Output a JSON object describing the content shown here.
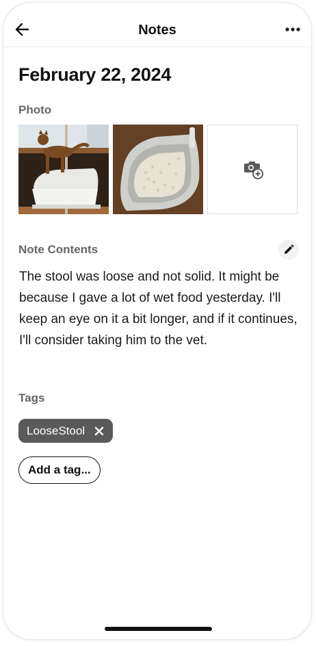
{
  "header": {
    "title": "Notes",
    "back_icon": "arrow-left-icon",
    "more_icon": "more-horizontal-icon"
  },
  "date": "February 22, 2024",
  "photo_section": {
    "label": "Photo",
    "photos": [
      {
        "description_icon": "photo-cat-litter-box"
      },
      {
        "description_icon": "photo-litter-tray"
      }
    ],
    "add_icon": "camera-plus-icon"
  },
  "note": {
    "label": "Note Contents",
    "edit_icon": "pencil-icon",
    "text": "The stool was loose and not solid. It might be because I gave a lot of wet food yesterday. I'll keep an eye on it a bit longer, and if it continues, I'll consider taking him to the vet."
  },
  "tags": {
    "label": "Tags",
    "items": [
      {
        "label": "LooseStool",
        "remove_icon": "close-icon"
      }
    ],
    "add_label": "Add a tag..."
  },
  "colors": {
    "chip_bg": "#5a5a5a",
    "section_label": "#666666",
    "text": "#1a1a1a"
  }
}
